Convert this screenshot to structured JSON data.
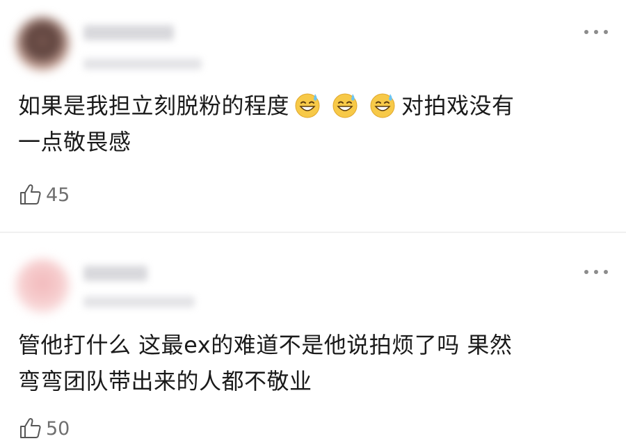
{
  "comments": [
    {
      "text_line1": "如果是我担立刻脱粉的程度",
      "emojis": [
        "grinning-sweat-emoji",
        "grinning-sweat-emoji",
        "grinning-sweat-emoji"
      ],
      "text_after_emoji": "对拍戏没有",
      "text_line2": "一点敬畏感",
      "likes": "45"
    },
    {
      "text_line1": "管他打什么 这最ex的难道不是他说拍烦了吗 果然",
      "text_line2": "弯弯团队带出来的人都不敬业",
      "likes": "50"
    }
  ],
  "colors": {
    "text": "#1a1a1a",
    "muted": "#6f6f6f",
    "divider": "#f0f0f0",
    "emoji_face": "#f7c948"
  },
  "icons": {
    "more": "more-dots-icon",
    "like": "thumbs-up-icon"
  }
}
